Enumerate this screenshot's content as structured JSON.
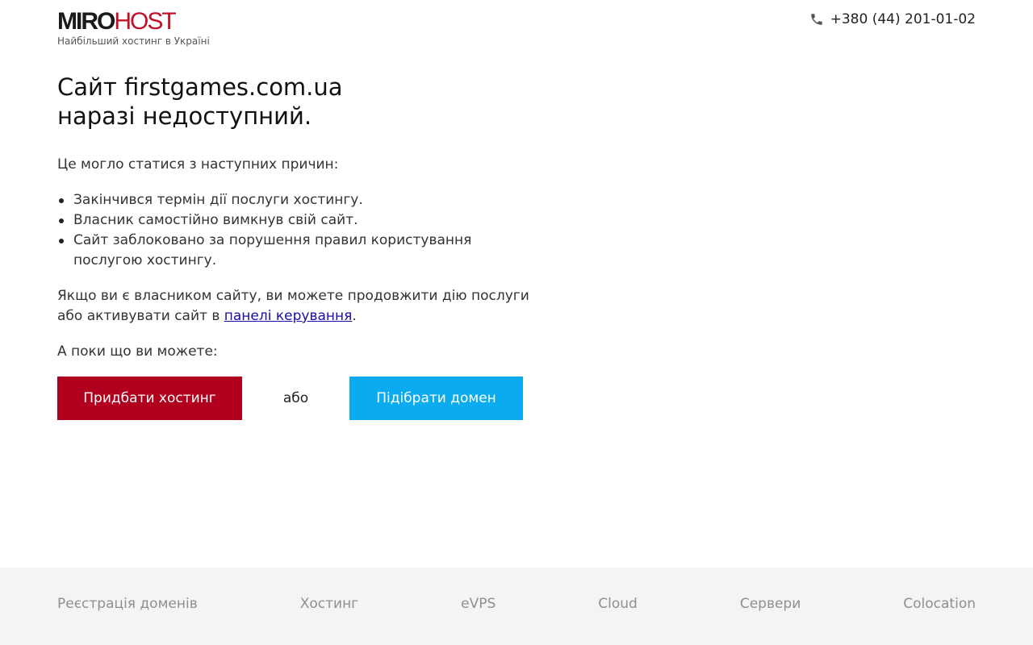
{
  "header": {
    "logo_part1": "MIRO",
    "logo_part2": "HOST",
    "tagline": "Найбільший хостинг в Україні",
    "phone_icon": "phone-icon",
    "phone": "+380 (44) 201-01-02"
  },
  "main": {
    "title_line1": "Сайт firstgames.com.ua",
    "title_line2": "наразі недоступний.",
    "intro": "Це могло статися з наступних причин:",
    "reasons": [
      "Закінчився термін дії послуги хостингу.",
      "Власник самостійно вимкнув свій сайт.",
      "Сайт заблоковано за порушення правил користування послугою хостингу."
    ],
    "owner_text_before": "Якщо ви є власником сайту, ви можете продовжити дію послуги або активувати сайт в ",
    "owner_link": "панелі керування",
    "owner_text_after": ".",
    "meanwhile": "А поки що ви можете:"
  },
  "actions": {
    "buy_hosting": "Придбати хостинг",
    "or": "або",
    "pick_domain": "Підібрати домен"
  },
  "footer": {
    "links": [
      "Реєстрація доменів",
      "Хостинг",
      "eVPS",
      "Cloud",
      "Сервери",
      "Colocation"
    ]
  },
  "colors": {
    "brand_red": "#b0001e",
    "accent_blue": "#0aacef",
    "footer_bg": "#f4f4f4",
    "footer_text": "#8f8f8f",
    "link": "#1a0dab"
  }
}
